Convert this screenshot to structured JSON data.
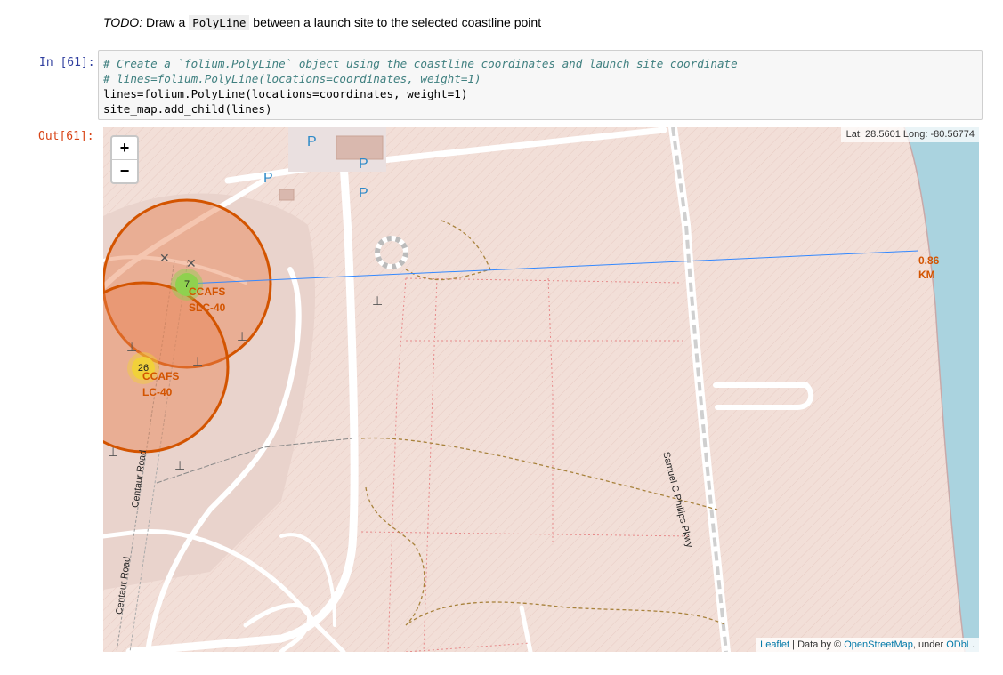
{
  "markdown": {
    "todo_label": "TODO:",
    "text_before": " Draw a ",
    "code": "PolyLine",
    "text_after": " between a launch site to the selected coastline point"
  },
  "cell": {
    "in_prompt": "In [61]:",
    "out_prompt": "Out[61]:",
    "code_lines": [
      "# Create a `folium.PolyLine` object using the coastline coordinates and launch site coordinate",
      "# lines=folium.PolyLine(locations=coordinates, weight=1)",
      "lines=folium.PolyLine(locations=coordinates, weight=1)",
      "site_map.add_child(lines)"
    ]
  },
  "map": {
    "zoom_in": "+",
    "zoom_out": "−",
    "mouse_position": "Lat: 28.5601 Long: -80.56774",
    "distance_label": "0.86 KM",
    "markers": [
      {
        "count": "7",
        "site": "CCAFS SLC-40",
        "color": "#8fd14f"
      },
      {
        "count": "26",
        "site": "CCAFS LC-40",
        "color": "#f1d13a"
      }
    ],
    "road_labels": [
      "Samuel C Phillips Pkwy",
      "Centaur Road",
      "Centaur Road"
    ],
    "parking_symbol": "P",
    "attribution": {
      "leaflet": "Leaflet",
      "sep1": " | Data by © ",
      "osm": "OpenStreetMap",
      "sep2": ", under ",
      "license": "ODbL",
      "end": "."
    },
    "colors": {
      "land": "#f2dfd8",
      "ocean": "#aad3df",
      "circle": "#d35400",
      "polyline": "#3388ff"
    }
  }
}
